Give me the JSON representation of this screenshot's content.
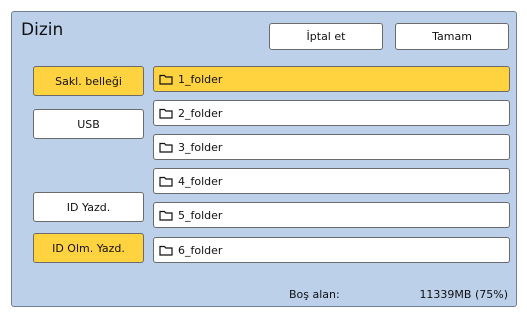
{
  "dialog": {
    "title": "Dizin",
    "cancel_label": "İptal et",
    "ok_label": "Tamam"
  },
  "sources": [
    {
      "label": "Sakl. belleği",
      "active": true
    },
    {
      "label": "USB",
      "active": false
    },
    {
      "label": "ID Yazd.",
      "active": false
    },
    {
      "label": "ID Olm. Yazd.",
      "active": true
    }
  ],
  "folders": [
    {
      "name": "1_folder",
      "selected": true
    },
    {
      "name": "2_folder",
      "selected": false
    },
    {
      "name": "3_folder",
      "selected": false
    },
    {
      "name": "4_folder",
      "selected": false
    },
    {
      "name": "5_folder",
      "selected": false
    },
    {
      "name": "6_folder",
      "selected": false
    }
  ],
  "footer": {
    "free_space_label": "Boş alan:",
    "free_space_value": "11339MB (75%)"
  },
  "colors": {
    "panel_bg": "#bdd0ea",
    "highlight": "#ffd23f"
  }
}
